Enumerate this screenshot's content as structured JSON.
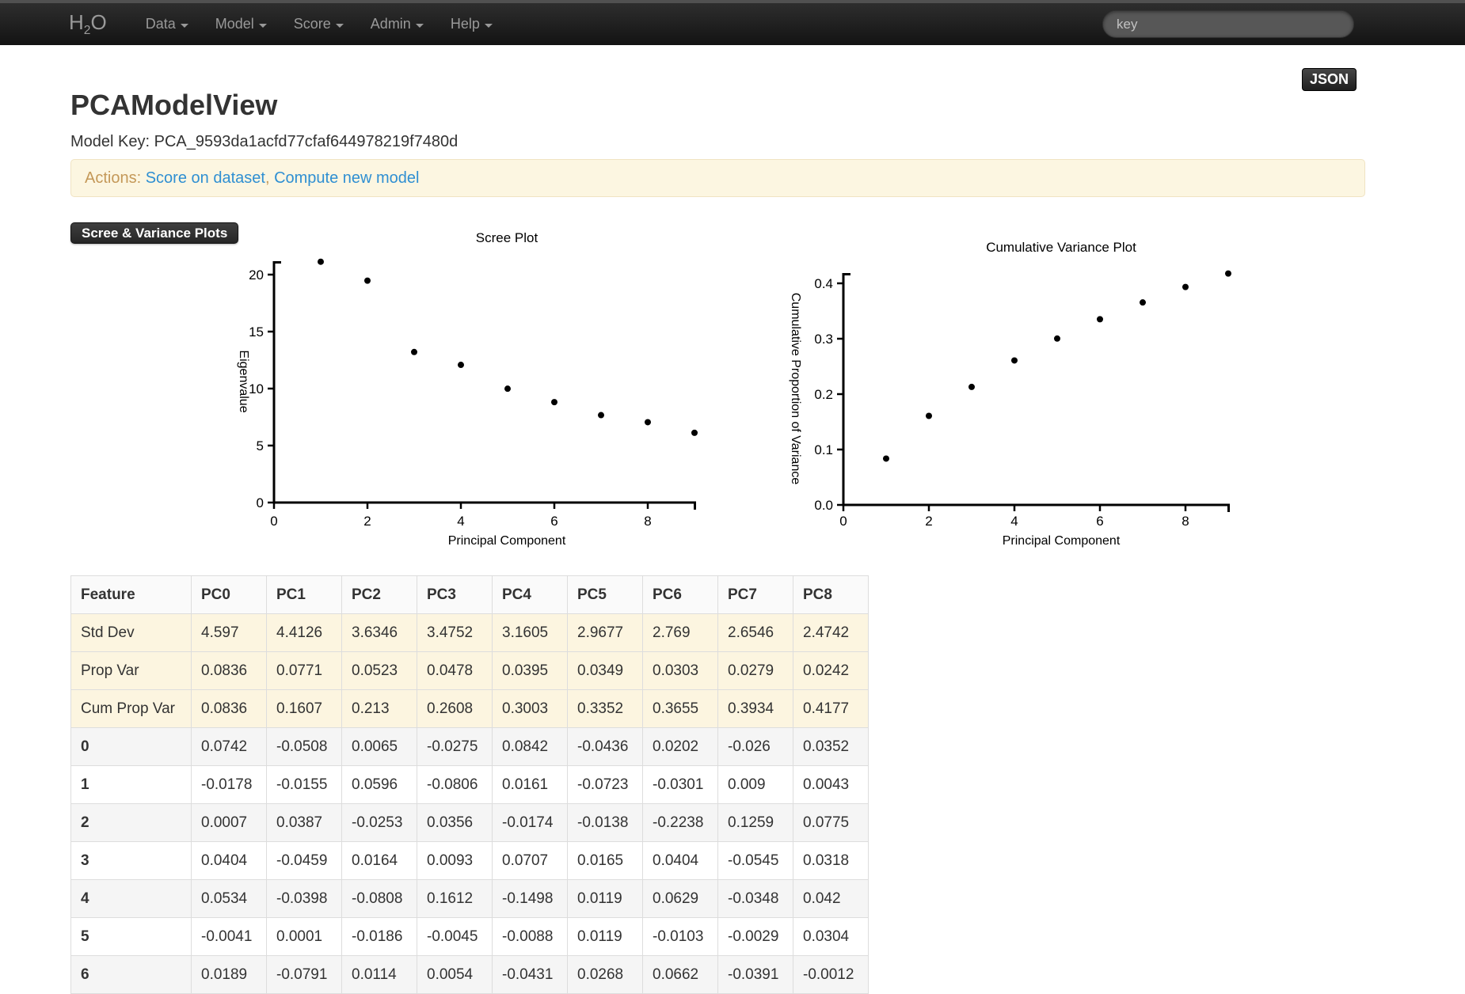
{
  "navbar": {
    "brand_parts": {
      "h": "H",
      "sub": "2",
      "o": "O"
    },
    "items": [
      {
        "label": "Data"
      },
      {
        "label": "Model"
      },
      {
        "label": "Score"
      },
      {
        "label": "Admin"
      },
      {
        "label": "Help"
      }
    ],
    "search_placeholder": "key"
  },
  "json_button_label": "JSON",
  "page": {
    "title": "PCAModelView",
    "model_key_label": "Model Key:",
    "model_key": "PCA_9593da1acfd77cfaf644978219f7480d"
  },
  "actions": {
    "label": "Actions:",
    "links": [
      {
        "label": "Score on dataset"
      },
      {
        "label": "Compute new model"
      }
    ],
    "separator": ", "
  },
  "plots_button_label": "Scree & Variance Plots",
  "chart_data": [
    {
      "type": "scatter",
      "title": "Scree Plot",
      "xlabel": "Principal Component",
      "ylabel": "Eigenvalue",
      "x": [
        1,
        2,
        3,
        4,
        5,
        6,
        7,
        8,
        9
      ],
      "y": [
        21.13,
        19.47,
        13.21,
        12.08,
        9.99,
        8.81,
        7.67,
        7.05,
        6.12
      ],
      "xlim": [
        0,
        9.05
      ],
      "ylim": [
        0,
        21.2
      ],
      "xticks": [
        0,
        2,
        4,
        6,
        8
      ],
      "xtick_labels": [
        "0",
        "2",
        "4",
        "6",
        "8"
      ],
      "yticks": [
        0,
        5,
        10,
        15,
        20
      ],
      "ytick_labels": [
        "0",
        "5",
        "10",
        "15",
        "20"
      ],
      "grid": false,
      "marker_color": "#000000"
    },
    {
      "type": "scatter",
      "title": "Cumulative Variance Plot",
      "xlabel": "Principal Component",
      "ylabel": "Cumulative Proportion of Variance",
      "x": [
        1,
        2,
        3,
        4,
        5,
        6,
        7,
        8,
        9
      ],
      "y": [
        0.0836,
        0.1607,
        0.213,
        0.2608,
        0.3003,
        0.3352,
        0.3655,
        0.3934,
        0.4177
      ],
      "xlim": [
        0,
        9.05
      ],
      "ylim": [
        0,
        0.419
      ],
      "xticks": [
        0,
        2,
        4,
        6,
        8
      ],
      "xtick_labels": [
        "0",
        "2",
        "4",
        "6",
        "8"
      ],
      "yticks": [
        0,
        0.1,
        0.2,
        0.3,
        0.4
      ],
      "ytick_labels": [
        "0.0",
        "0.1",
        "0.2",
        "0.3",
        "0.4"
      ],
      "grid": false,
      "marker_color": "#000000"
    }
  ],
  "table": {
    "columns": [
      "Feature",
      "PC0",
      "PC1",
      "PC2",
      "PC3",
      "PC4",
      "PC5",
      "PC6",
      "PC7",
      "PC8"
    ],
    "rows": [
      {
        "label": "Std Dev",
        "style": "warning",
        "bold_label": false,
        "values": [
          "4.597",
          "4.4126",
          "3.6346",
          "3.4752",
          "3.1605",
          "2.9677",
          "2.769",
          "2.6546",
          "2.4742"
        ]
      },
      {
        "label": "Prop Var",
        "style": "warning",
        "bold_label": false,
        "values": [
          "0.0836",
          "0.0771",
          "0.0523",
          "0.0478",
          "0.0395",
          "0.0349",
          "0.0303",
          "0.0279",
          "0.0242"
        ]
      },
      {
        "label": "Cum Prop Var",
        "style": "warning",
        "bold_label": false,
        "values": [
          "0.0836",
          "0.1607",
          "0.213",
          "0.2608",
          "0.3003",
          "0.3352",
          "0.3655",
          "0.3934",
          "0.4177"
        ]
      },
      {
        "label": "0",
        "style": "stripe",
        "bold_label": true,
        "values": [
          "0.0742",
          "-0.0508",
          "0.0065",
          "-0.0275",
          "0.0842",
          "-0.0436",
          "0.0202",
          "-0.026",
          "0.0352"
        ]
      },
      {
        "label": "1",
        "style": "plain",
        "bold_label": true,
        "values": [
          "-0.0178",
          "-0.0155",
          "0.0596",
          "-0.0806",
          "0.0161",
          "-0.0723",
          "-0.0301",
          "0.009",
          "0.0043"
        ]
      },
      {
        "label": "2",
        "style": "stripe",
        "bold_label": true,
        "values": [
          "0.0007",
          "0.0387",
          "-0.0253",
          "0.0356",
          "-0.0174",
          "-0.0138",
          "-0.2238",
          "0.1259",
          "0.0775"
        ]
      },
      {
        "label": "3",
        "style": "plain",
        "bold_label": true,
        "values": [
          "0.0404",
          "-0.0459",
          "0.0164",
          "0.0093",
          "0.0707",
          "0.0165",
          "0.0404",
          "-0.0545",
          "0.0318"
        ]
      },
      {
        "label": "4",
        "style": "stripe",
        "bold_label": true,
        "values": [
          "0.0534",
          "-0.0398",
          "-0.0808",
          "0.1612",
          "-0.1498",
          "0.0119",
          "0.0629",
          "-0.0348",
          "0.042"
        ]
      },
      {
        "label": "5",
        "style": "plain",
        "bold_label": true,
        "values": [
          "-0.0041",
          "0.0001",
          "-0.0186",
          "-0.0045",
          "-0.0088",
          "0.0119",
          "-0.0103",
          "-0.0029",
          "0.0304"
        ]
      },
      {
        "label": "6",
        "style": "stripe",
        "bold_label": true,
        "values": [
          "0.0189",
          "-0.0791",
          "0.0114",
          "0.0054",
          "-0.0431",
          "0.0268",
          "0.0662",
          "-0.0391",
          "-0.0012"
        ]
      }
    ]
  },
  "colors": {
    "navbar_bg_top": "#2e2e2e",
    "navbar_bg_bottom": "#131313",
    "nav_text": "#999999",
    "link_blue": "#2f8fd2",
    "alert_bg": "#fcf6e1",
    "alert_border": "#f0e3c2",
    "alert_text": "#c49858",
    "warning_row_bg": "#fcf5e0",
    "stripe_row_bg": "#f5f5f5",
    "table_border": "#dddddd",
    "axis_color": "#000000"
  }
}
